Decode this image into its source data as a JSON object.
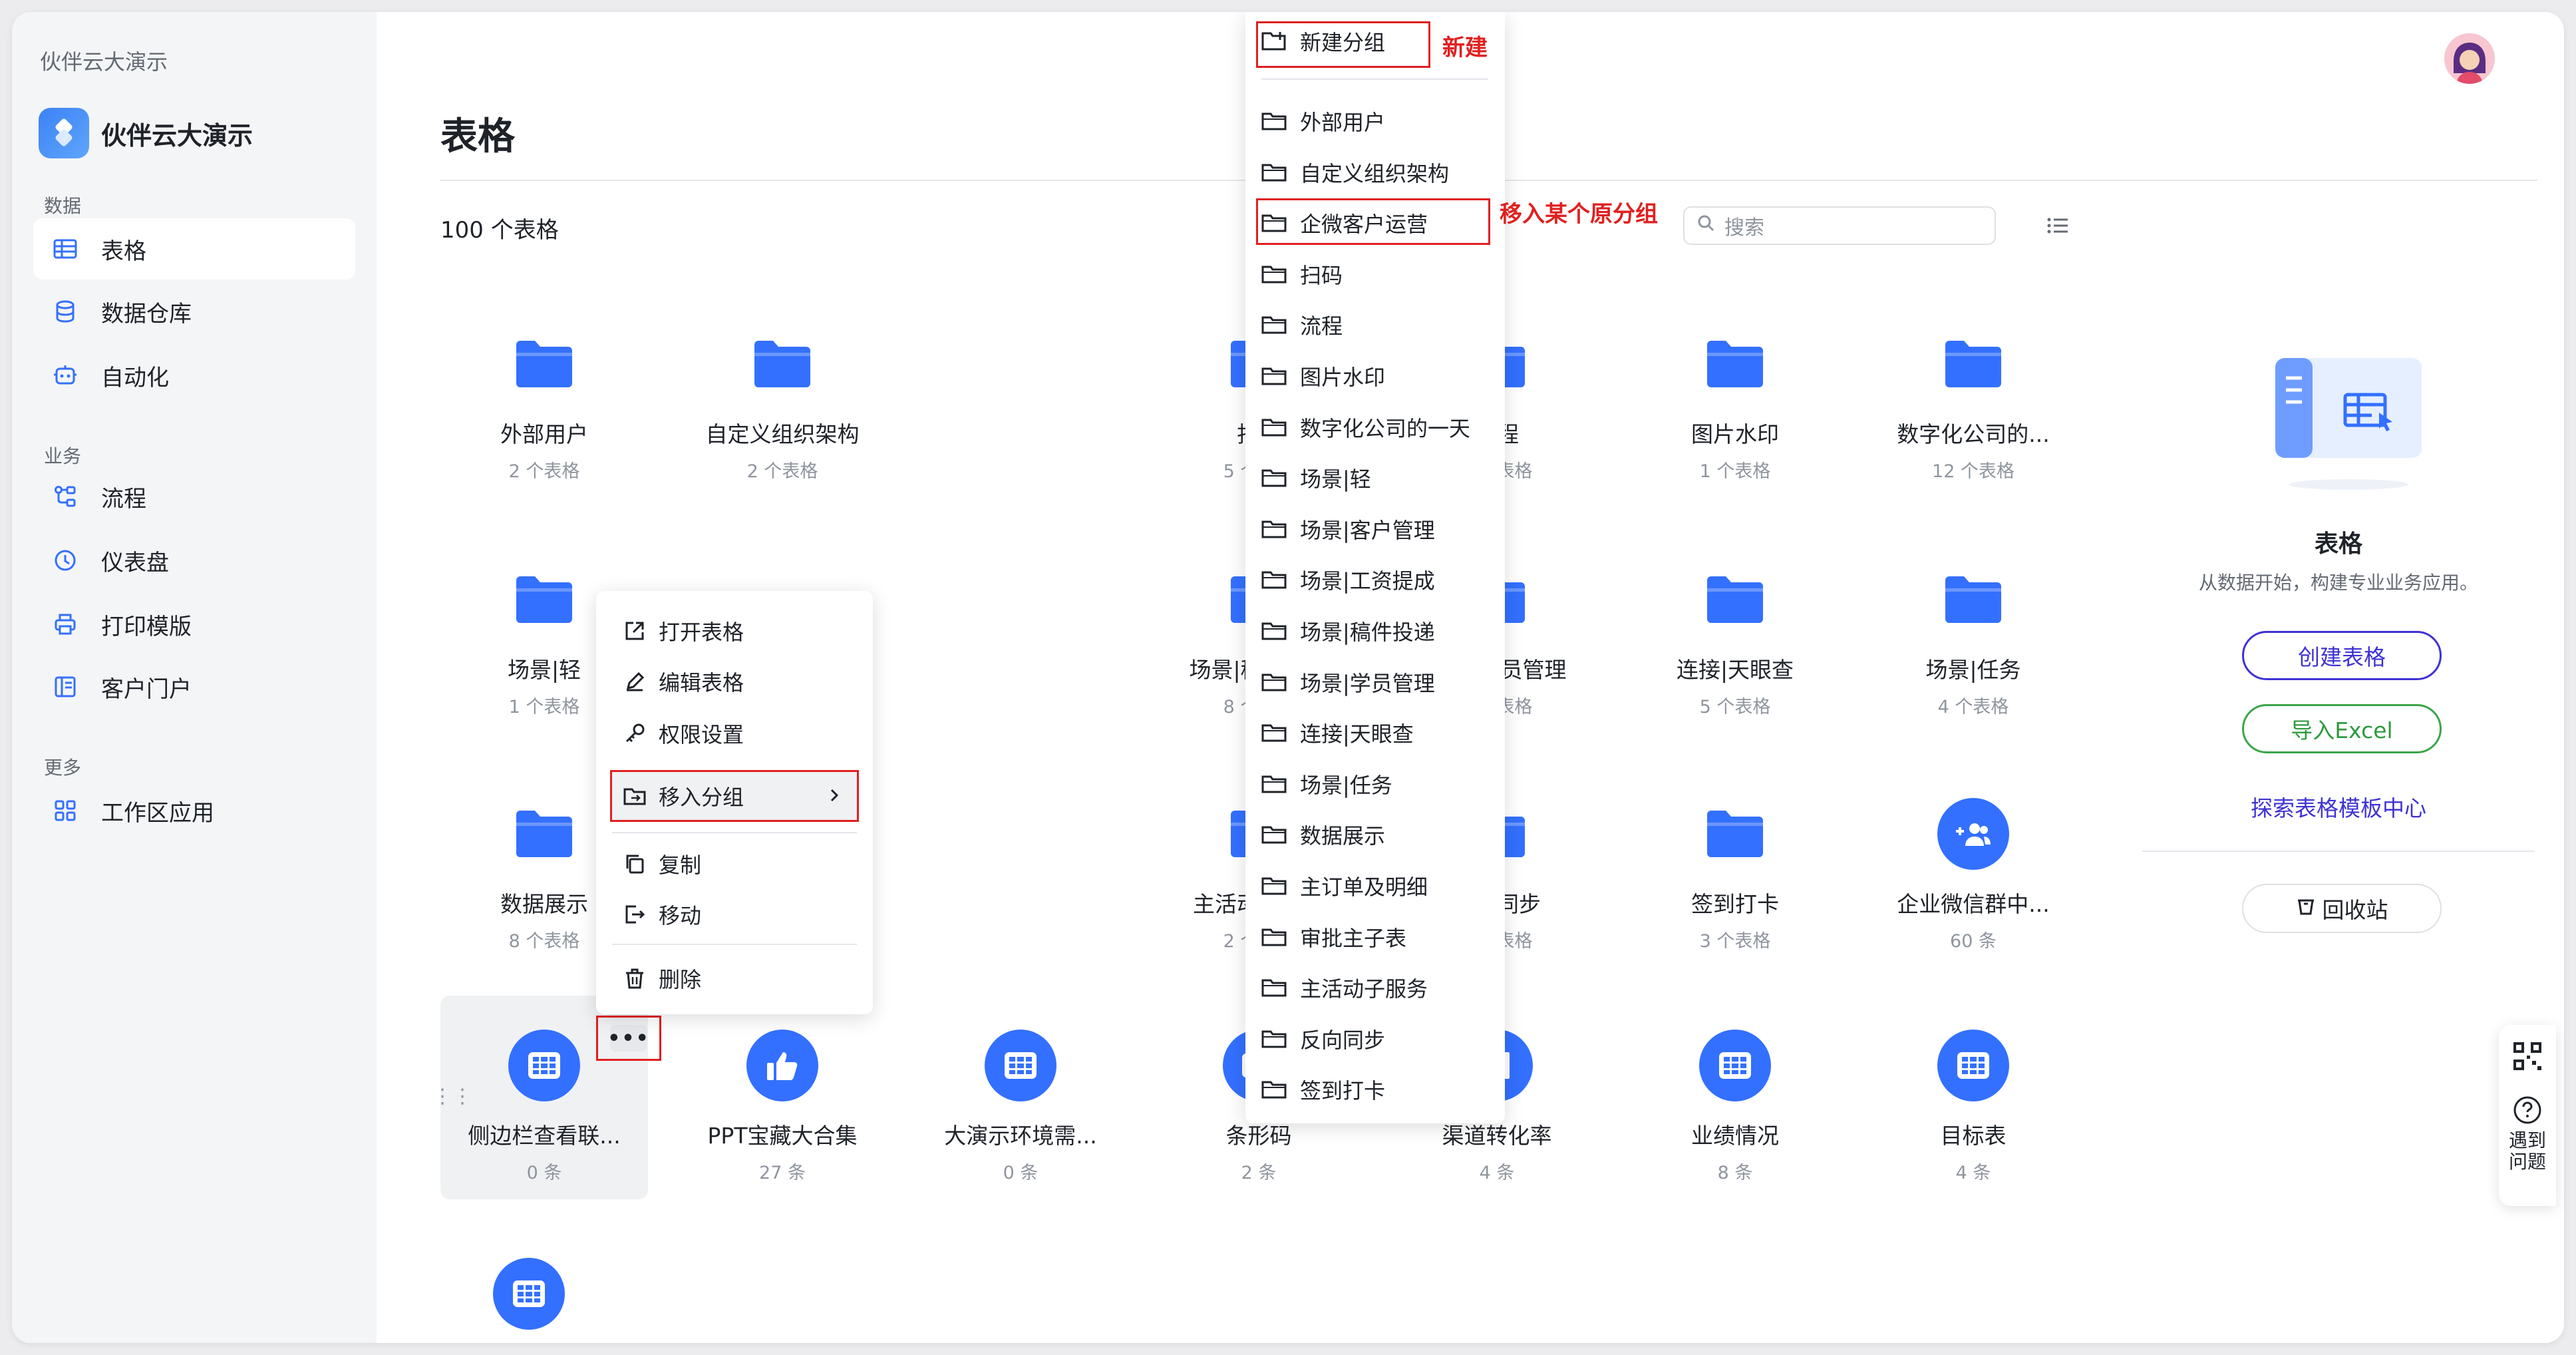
{
  "workspace": {
    "name": "伙伴云大演示",
    "app_name": "伙伴云大演示"
  },
  "sidebar": {
    "sections": [
      {
        "label": "数据",
        "items": [
          {
            "label": "表格",
            "icon": "table-icon"
          },
          {
            "label": "数据仓库",
            "icon": "database-icon"
          },
          {
            "label": "自动化",
            "icon": "robot-icon"
          }
        ]
      },
      {
        "label": "业务",
        "items": [
          {
            "label": "流程",
            "icon": "flow-icon"
          },
          {
            "label": "仪表盘",
            "icon": "clock-icon"
          },
          {
            "label": "打印模版",
            "icon": "printer-icon"
          },
          {
            "label": "客户门户",
            "icon": "portal-icon"
          }
        ]
      },
      {
        "label": "更多",
        "items": [
          {
            "label": "工作区应用",
            "icon": "apps-icon"
          }
        ]
      }
    ]
  },
  "main": {
    "title": "表格",
    "count": "100 个表格",
    "search_placeholder": "搜索",
    "tiles": [
      {
        "t": "外部用户",
        "s": "2 个表格",
        "icon": "folder"
      },
      {
        "t": "自定义组织架构",
        "s": "2 个表格",
        "icon": "folder"
      },
      {
        "t": "扫码",
        "s": "5 个表格",
        "icon": "folder"
      },
      {
        "t": "流程",
        "s": "1 个表格",
        "icon": "folder"
      },
      {
        "t": "图片水印",
        "s": "1 个表格",
        "icon": "folder"
      },
      {
        "t": "数字化公司的...",
        "s": "12 个表格",
        "icon": "folder"
      },
      {
        "t": "场景|轻",
        "s": "1 个表格",
        "icon": "folder"
      },
      {
        "t": "场景|稿件投递",
        "s": "8 个表格",
        "icon": "folder"
      },
      {
        "t": "场景|学员管理",
        "s": "7 个表格",
        "icon": "folder"
      },
      {
        "t": "连接|天眼查",
        "s": "5 个表格",
        "icon": "folder"
      },
      {
        "t": "场景|任务",
        "s": "4 个表格",
        "icon": "folder"
      },
      {
        "t": "数据展示",
        "s": "8 个表格",
        "icon": "folder"
      },
      {
        "t": "主活动子服务",
        "s": "2 个表格",
        "icon": "folder"
      },
      {
        "t": "反向同步",
        "s": "1 个表格",
        "icon": "folder"
      },
      {
        "t": "签到打卡",
        "s": "3 个表格",
        "icon": "folder"
      },
      {
        "t": "企业微信群中...",
        "s": "60 条",
        "icon": "group-add-icon"
      },
      {
        "t": "侧边栏查看联...",
        "s": "0 条",
        "icon": "grid-table-icon"
      },
      {
        "t": "PPT宝藏大合集",
        "s": "27 条",
        "icon": "thumbs-up-icon"
      },
      {
        "t": "大演示环境需...",
        "s": "0 条",
        "icon": "grid-table-icon"
      },
      {
        "t": "条形码",
        "s": "2 条",
        "icon": "keyboard-icon"
      },
      {
        "t": "渠道转化率",
        "s": "4 条",
        "icon": "bar-chart-icon"
      },
      {
        "t": "业绩情况",
        "s": "8 条",
        "icon": "grid-table-icon"
      },
      {
        "t": "目标表",
        "s": "4 条",
        "icon": "grid-table-icon"
      }
    ]
  },
  "context_menu": {
    "items": [
      "打开表格",
      "编辑表格",
      "权限设置",
      "移入分组",
      "复制",
      "移动",
      "删除"
    ]
  },
  "group_menu": {
    "new_label": "新建分组",
    "groups": [
      "外部用户",
      "自定义组织架构",
      "企微客户运营",
      "扫码",
      "流程",
      "图片水印",
      "数字化公司的一天",
      "场景|轻",
      "场景|客户管理",
      "场景|工资提成",
      "场景|稿件投递",
      "场景|学员管理",
      "连接|天眼查",
      "场景|任务",
      "数据展示",
      "主订单及明细",
      "审批主子表",
      "主活动子服务",
      "反向同步",
      "签到打卡"
    ]
  },
  "annotations": {
    "new": "新建",
    "move": "移入某个原分组"
  },
  "panel": {
    "title": "表格",
    "desc": "从数据开始，构建专业业务应用。",
    "create": "创建表格",
    "import": "导入Excel",
    "explore": "探索表格模板中心",
    "recycle": "回收站"
  },
  "help": {
    "label": "遇到问题"
  },
  "colors": {
    "accent": "#3370ff",
    "annotation": "#e02020",
    "create": "#3f32d3",
    "import": "#2e9a3d"
  }
}
